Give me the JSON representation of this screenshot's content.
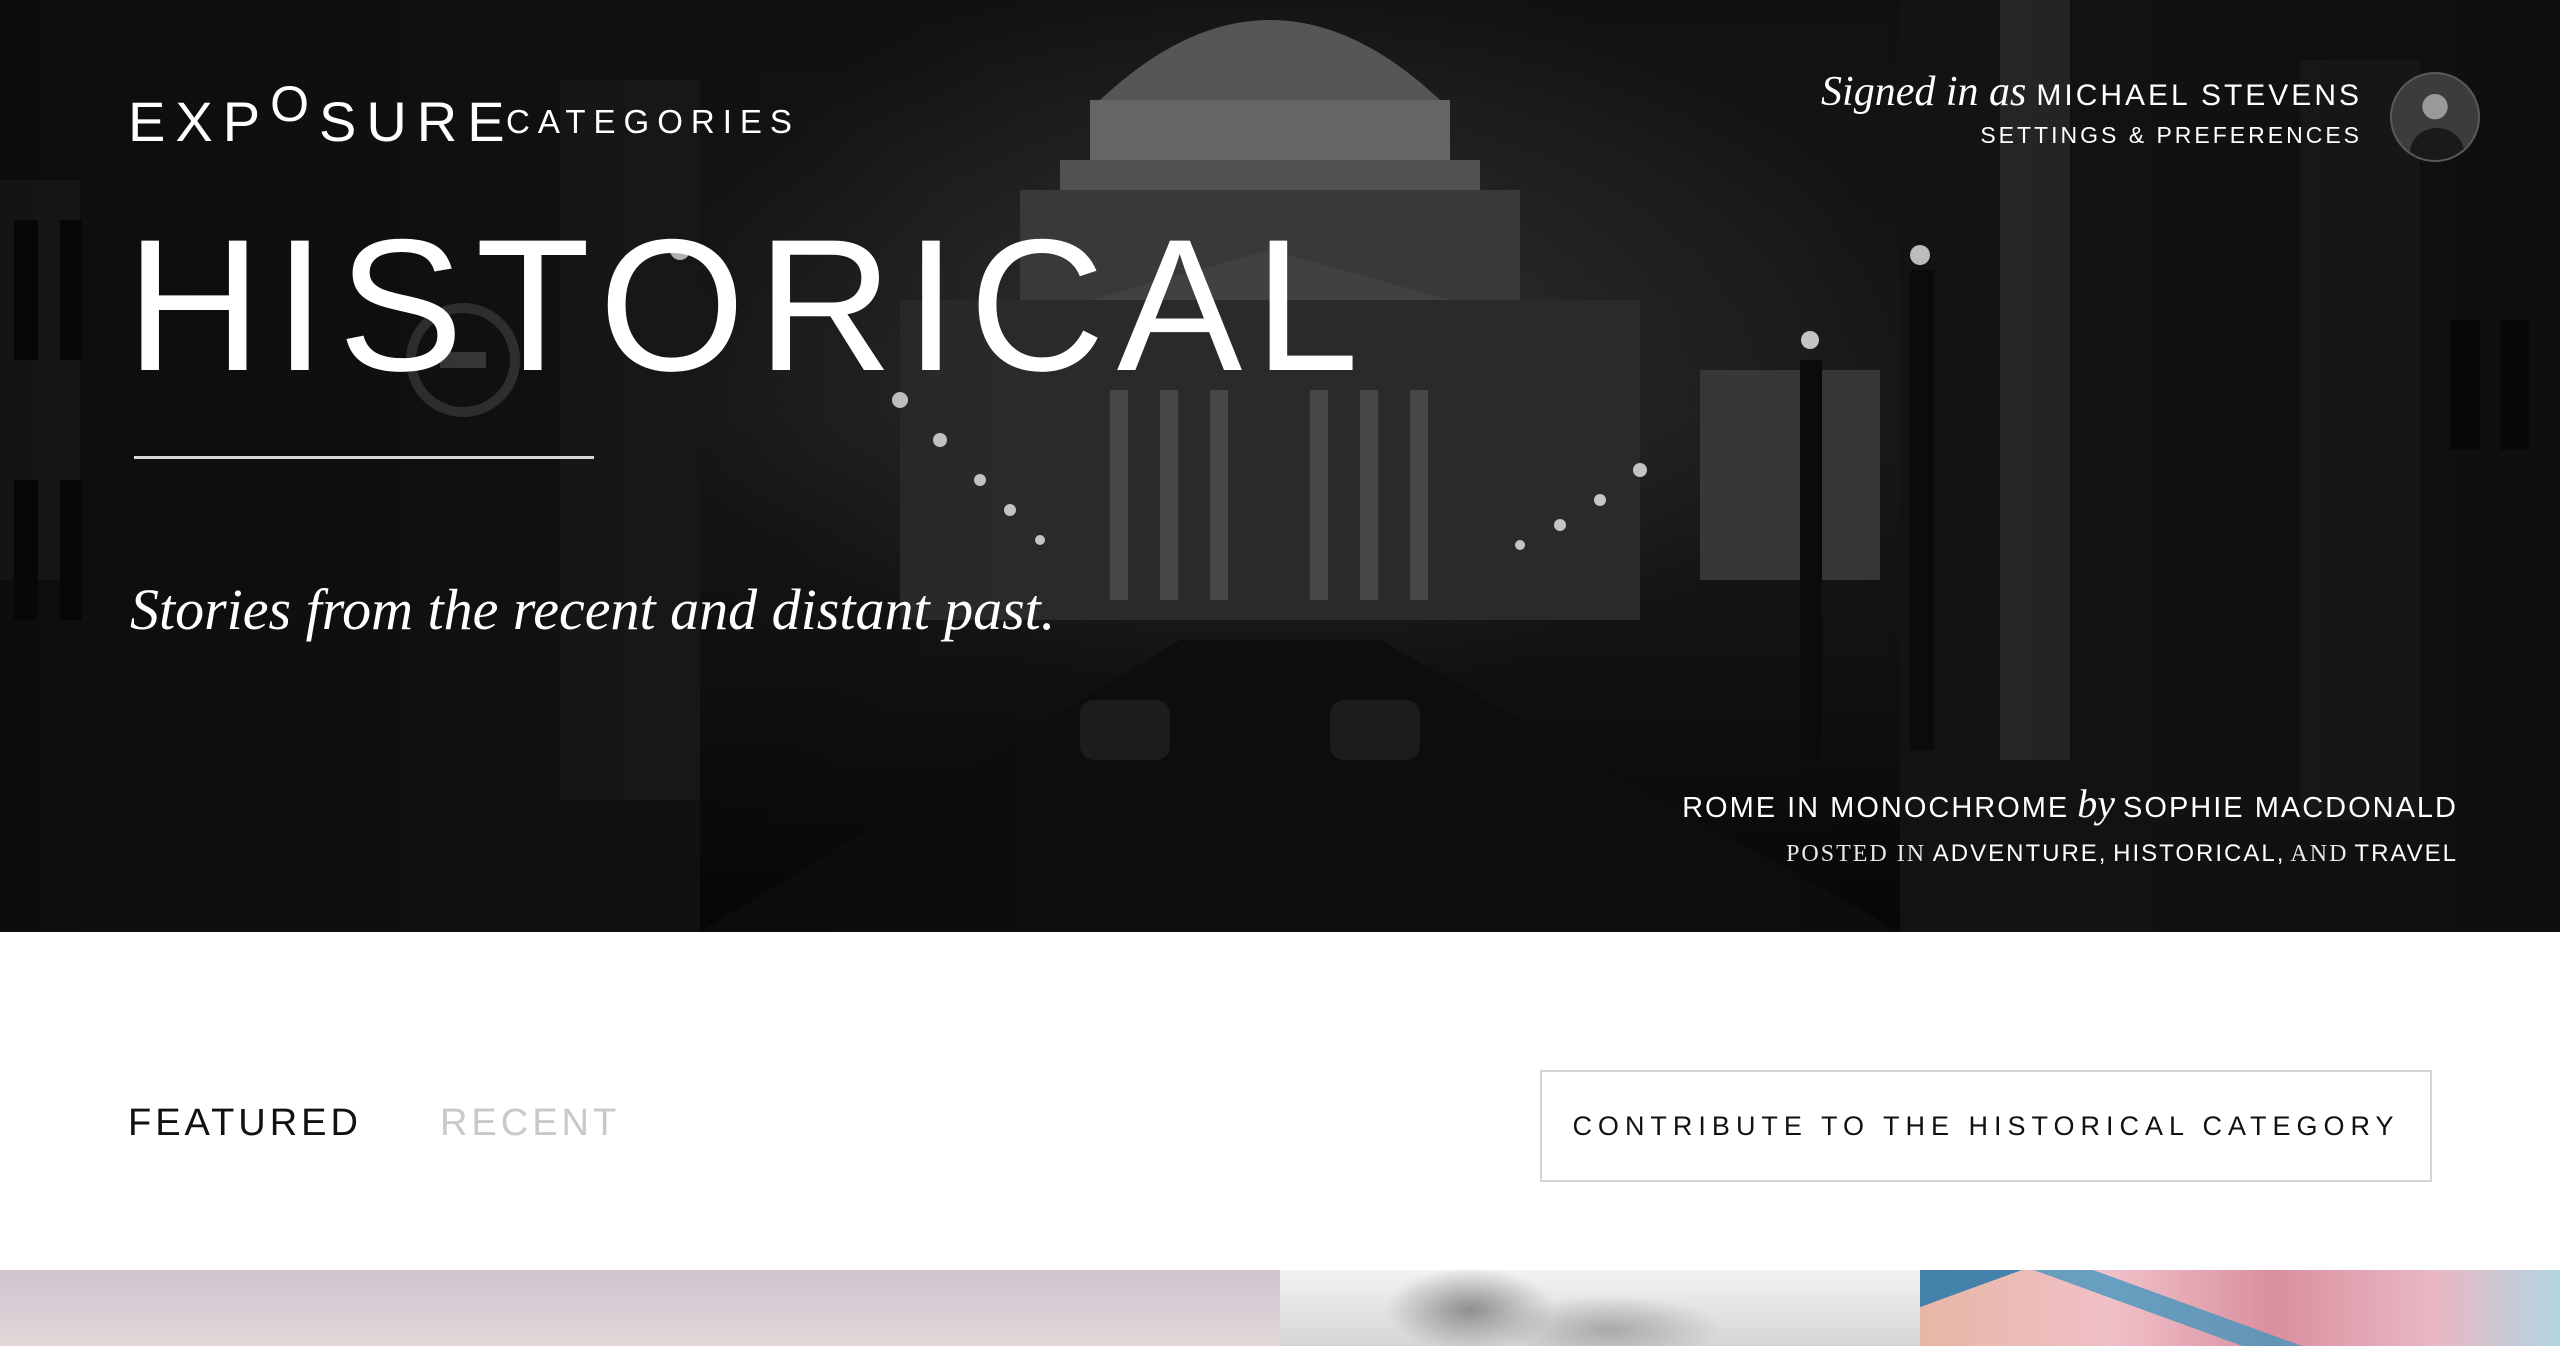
{
  "header": {
    "logo_text": "EXPOSURE",
    "logo_parts": [
      "EXP",
      "O",
      "SURE"
    ],
    "nav_categories": "CATEGORIES"
  },
  "user": {
    "signed_in_prefix": "Signed in as",
    "name": "MICHAEL STEVENS",
    "settings_link": "SETTINGS & PREFERENCES",
    "avatar_icon": "user-avatar-photo"
  },
  "hero": {
    "title": "HISTORICAL",
    "tagline": "Stories from the recent and distant past.",
    "credit": {
      "story_title": "ROME IN MONOCHROME",
      "by": "by",
      "author": "SOPHIE MACDONALD",
      "posted_in": "POSTED IN",
      "categories": [
        "ADVENTURE",
        "HISTORICAL",
        "TRAVEL"
      ],
      "separator": ",",
      "and": "AND"
    }
  },
  "tabs": [
    {
      "label": "FEATURED",
      "active": true
    },
    {
      "label": "RECENT",
      "active": false
    }
  ],
  "cta": {
    "label": "CONTRIBUTE TO THE HISTORICAL CATEGORY"
  },
  "colors": {
    "hero_text": "#ffffff",
    "tab_active": "#111111",
    "tab_inactive": "#c9c9c9",
    "cta_border": "#d4d4d4"
  }
}
